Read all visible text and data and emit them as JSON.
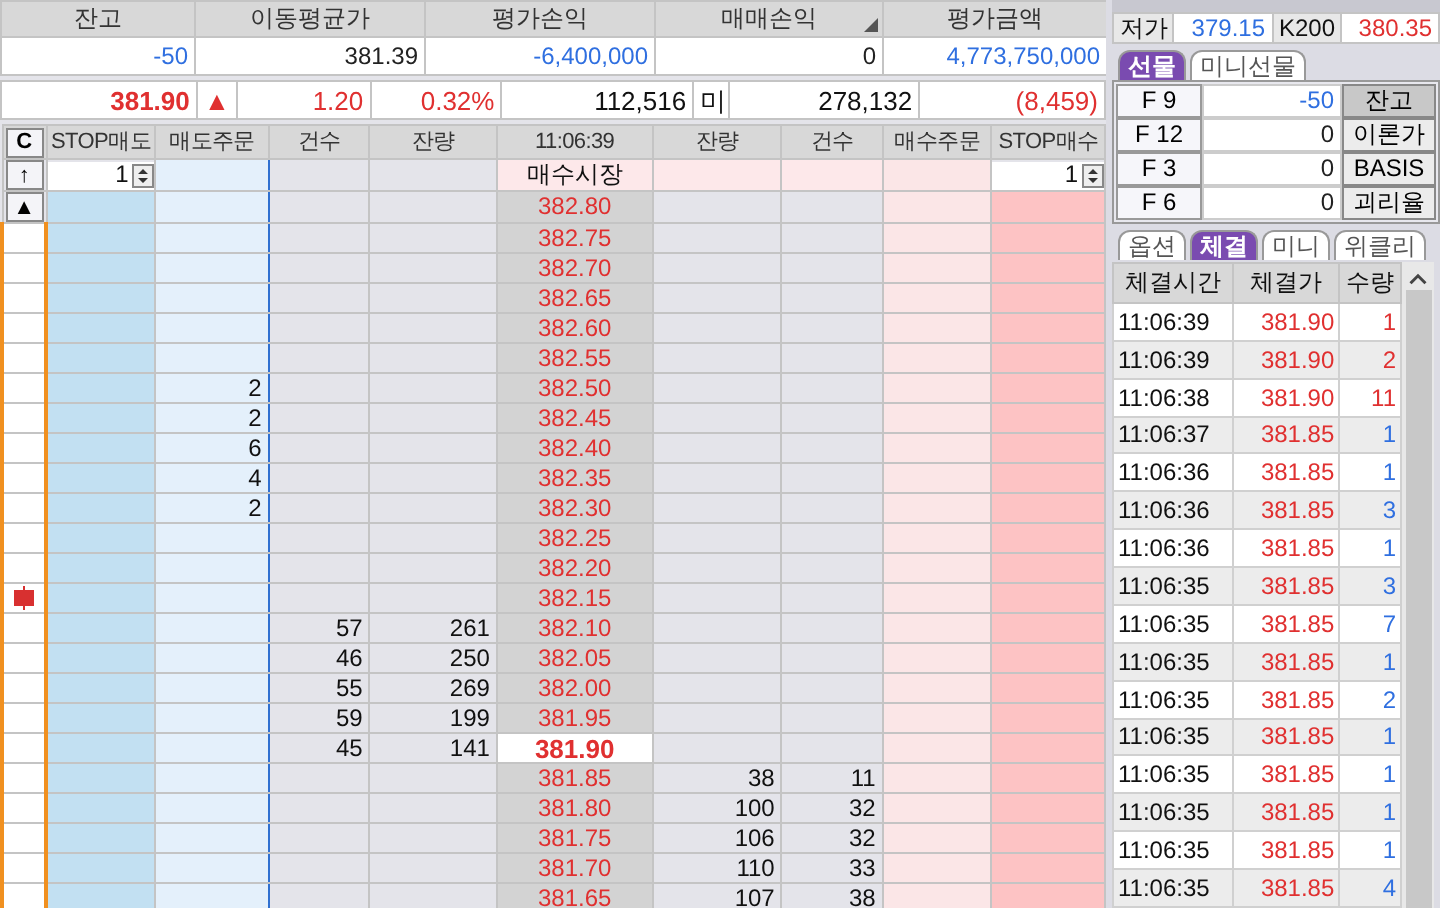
{
  "account": {
    "columns": [
      {
        "label": "잔고",
        "sort": false
      },
      {
        "label": "이동평균가",
        "sort": false
      },
      {
        "label": "평가손익",
        "sort": false
      },
      {
        "label": "매매손익",
        "sort": true
      },
      {
        "label": "평가금액",
        "sort": false
      }
    ],
    "values": [
      {
        "text": "-50",
        "color": "#2f6fe0"
      },
      {
        "text": "381.39",
        "color": "#222222"
      },
      {
        "text": "-6,400,000",
        "color": "#2f6fe0"
      },
      {
        "text": "0",
        "color": "#222222"
      },
      {
        "text": "4,773,750,000",
        "color": "#2f6fe0"
      }
    ]
  },
  "quote": {
    "price": "381.90",
    "arrow": "▲",
    "change": "1.20",
    "rate": "0.32%",
    "volume": "112,516",
    "oi_label": "미",
    "open_interest": "278,132",
    "oi_change": "(8,459)"
  },
  "order_book": {
    "side_buttons": [
      "C",
      "↑",
      "▲"
    ],
    "columns": [
      "STOP매도",
      "매도주문",
      "건수",
      "잔량",
      "11:06:39",
      "잔량",
      "건수",
      "매수주문",
      "STOP매수"
    ],
    "market_row": {
      "sell_stop_qty": "1",
      "label": "매수시장",
      "buy_stop_qty": "1"
    },
    "rows": [
      {
        "price": "382.80",
        "current": false,
        "marker": false
      },
      {
        "price": "382.75",
        "current": false,
        "marker": false
      },
      {
        "price": "382.70",
        "current": false,
        "marker": false
      },
      {
        "price": "382.65",
        "current": false,
        "marker": false
      },
      {
        "price": "382.60",
        "current": false,
        "marker": false
      },
      {
        "price": "382.55",
        "current": false,
        "marker": false
      },
      {
        "price": "382.50",
        "sell_order": "2",
        "current": false,
        "marker": false
      },
      {
        "price": "382.45",
        "sell_order": "2",
        "current": false,
        "marker": false
      },
      {
        "price": "382.40",
        "sell_order": "6",
        "current": false,
        "marker": false
      },
      {
        "price": "382.35",
        "sell_order": "4",
        "current": false,
        "marker": false
      },
      {
        "price": "382.30",
        "sell_order": "2",
        "current": false,
        "marker": false
      },
      {
        "price": "382.25",
        "current": false,
        "marker": false
      },
      {
        "price": "382.20",
        "current": false,
        "marker": false
      },
      {
        "price": "382.15",
        "current": false,
        "marker": true
      },
      {
        "price": "382.10",
        "sell_count": "57",
        "sell_qty": "261",
        "current": false,
        "marker": false
      },
      {
        "price": "382.05",
        "sell_count": "46",
        "sell_qty": "250",
        "current": false,
        "marker": false
      },
      {
        "price": "382.00",
        "sell_count": "55",
        "sell_qty": "269",
        "current": false,
        "marker": false
      },
      {
        "price": "381.95",
        "sell_count": "59",
        "sell_qty": "199",
        "current": false,
        "marker": false
      },
      {
        "price": "381.90",
        "sell_count": "45",
        "sell_qty": "141",
        "current": true,
        "marker": false
      },
      {
        "price": "381.85",
        "buy_qty": "38",
        "buy_count": "11",
        "current": false,
        "marker": false
      },
      {
        "price": "381.80",
        "buy_qty": "100",
        "buy_count": "32",
        "current": false,
        "marker": false
      },
      {
        "price": "381.75",
        "buy_qty": "106",
        "buy_count": "32",
        "current": false,
        "marker": false
      },
      {
        "price": "381.70",
        "buy_qty": "110",
        "buy_count": "33",
        "current": false,
        "marker": false
      },
      {
        "price": "381.65",
        "buy_qty": "107",
        "buy_count": "38",
        "current": false,
        "marker": false
      }
    ]
  },
  "info_row": [
    {
      "label": "저가",
      "value": "379.15",
      "color": "#2f6fe0"
    },
    {
      "label": "K200",
      "value": "380.35",
      "color": "#e03030"
    }
  ],
  "futures_tabs": [
    {
      "label": "선물",
      "selected": true
    },
    {
      "label": "미니선물",
      "selected": false
    }
  ],
  "futures": [
    {
      "code": "F 9",
      "qty": "-50",
      "color": "#2f6fe0",
      "action": "잔고",
      "pressed": true
    },
    {
      "code": "F 12",
      "qty": "0",
      "color": "#222222",
      "action": "이론가",
      "pressed": false
    },
    {
      "code": "F 3",
      "qty": "0",
      "color": "#222222",
      "action": "BASIS",
      "pressed": false
    },
    {
      "code": "F 6",
      "qty": "0",
      "color": "#222222",
      "action": "괴리율",
      "pressed": false
    }
  ],
  "trade_tabs": [
    {
      "label": "옵션",
      "selected": false
    },
    {
      "label": "체결",
      "selected": true
    },
    {
      "label": "미니",
      "selected": false
    },
    {
      "label": "위클리",
      "selected": false
    }
  ],
  "trades": {
    "columns": [
      "체결시간",
      "체결가",
      "수량"
    ],
    "rows": [
      {
        "time": "11:06:39",
        "price": "381.90",
        "qty": "1",
        "color": "#e03030"
      },
      {
        "time": "11:06:39",
        "price": "381.90",
        "qty": "2",
        "color": "#e03030"
      },
      {
        "time": "11:06:38",
        "price": "381.90",
        "qty": "11",
        "color": "#e03030"
      },
      {
        "time": "11:06:37",
        "price": "381.85",
        "qty": "1",
        "color": "#2f6fe0"
      },
      {
        "time": "11:06:36",
        "price": "381.85",
        "qty": "1",
        "color": "#2f6fe0"
      },
      {
        "time": "11:06:36",
        "price": "381.85",
        "qty": "3",
        "color": "#2f6fe0"
      },
      {
        "time": "11:06:36",
        "price": "381.85",
        "qty": "1",
        "color": "#2f6fe0"
      },
      {
        "time": "11:06:35",
        "price": "381.85",
        "qty": "3",
        "color": "#2f6fe0"
      },
      {
        "time": "11:06:35",
        "price": "381.85",
        "qty": "7",
        "color": "#2f6fe0"
      },
      {
        "time": "11:06:35",
        "price": "381.85",
        "qty": "1",
        "color": "#2f6fe0"
      },
      {
        "time": "11:06:35",
        "price": "381.85",
        "qty": "2",
        "color": "#2f6fe0"
      },
      {
        "time": "11:06:35",
        "price": "381.85",
        "qty": "1",
        "color": "#2f6fe0"
      },
      {
        "time": "11:06:35",
        "price": "381.85",
        "qty": "1",
        "color": "#2f6fe0"
      },
      {
        "time": "11:06:35",
        "price": "381.85",
        "qty": "1",
        "color": "#2f6fe0"
      },
      {
        "time": "11:06:35",
        "price": "381.85",
        "qty": "1",
        "color": "#2f6fe0"
      },
      {
        "time": "11:06:35",
        "price": "381.85",
        "qty": "4",
        "color": "#2f6fe0"
      }
    ]
  }
}
